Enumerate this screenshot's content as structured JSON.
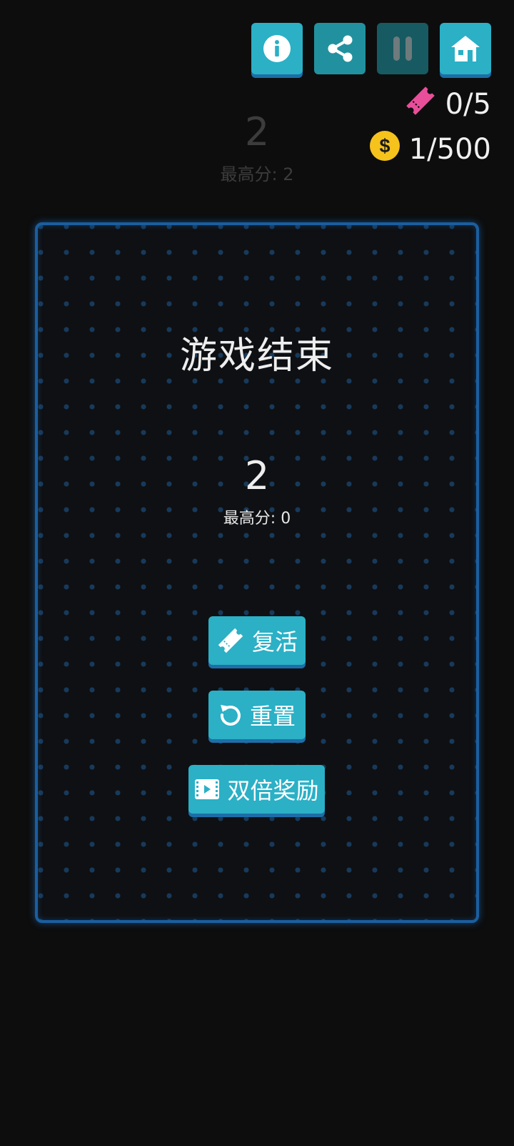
{
  "toolbar": {
    "buttons": [
      {
        "name": "info",
        "icon": "info-icon"
      },
      {
        "name": "share",
        "icon": "share-icon"
      },
      {
        "name": "pause",
        "icon": "pause-icon"
      },
      {
        "name": "home",
        "icon": "home-icon"
      }
    ]
  },
  "resources": {
    "tickets": {
      "icon": "ticket-icon",
      "value": "0/5",
      "color": "#e94e9a"
    },
    "coins": {
      "icon": "coin-icon",
      "value": "1/500",
      "color": "#f6c21c"
    }
  },
  "background_score": {
    "score": "2",
    "best": "最高分:  2"
  },
  "game_over": {
    "title": "游戏结束",
    "score": "2",
    "best": "最高分:  0"
  },
  "actions": {
    "revive": {
      "label": "复活",
      "icon": "ticket-icon"
    },
    "reset": {
      "label": "重置",
      "icon": "restart-icon"
    },
    "double": {
      "label": "双倍奖励",
      "icon": "video-icon"
    }
  },
  "colors": {
    "accent": "#2bb0c6",
    "accent_shadow": "#1d6ea8",
    "board_border": "#1b5e9e",
    "background": "#0d0d0d"
  }
}
